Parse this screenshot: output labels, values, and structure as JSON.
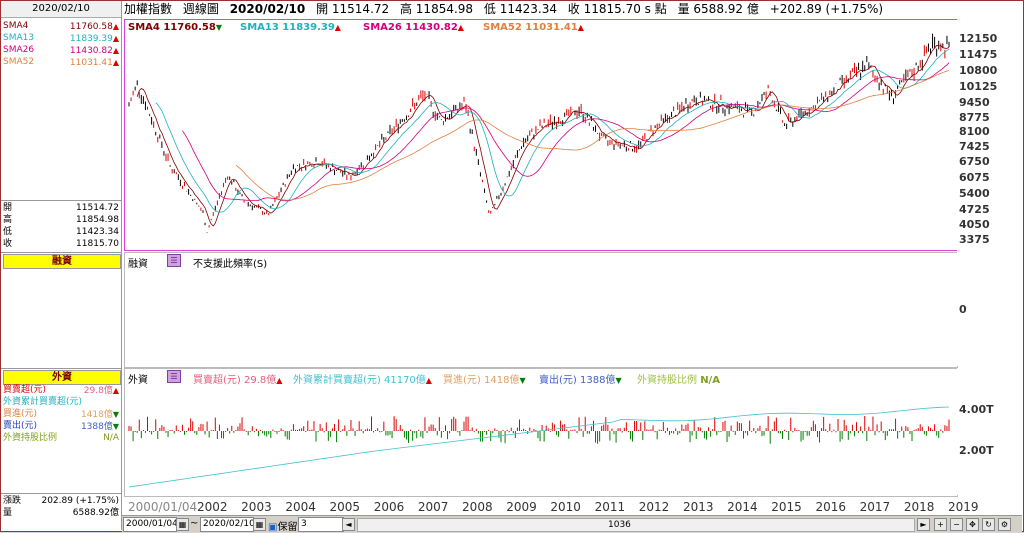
{
  "left_panel": {
    "date": "2020/02/10",
    "sma": [
      {
        "label": "SMA4",
        "value": "11760.58",
        "dir": "up",
        "color": "#800000"
      },
      {
        "label": "SMA13",
        "value": "11839.39",
        "dir": "up",
        "color": "#20b0c0"
      },
      {
        "label": "SMA26",
        "value": "11430.82",
        "dir": "up",
        "color": "#d00080"
      },
      {
        "label": "SMA52",
        "value": "11031.41",
        "dir": "up",
        "color": "#e08040"
      }
    ],
    "ohlc": [
      {
        "label": "開",
        "value": "11514.72"
      },
      {
        "label": "高",
        "value": "11854.98"
      },
      {
        "label": "低",
        "value": "11423.34"
      },
      {
        "label": "收",
        "value": "11815.70"
      }
    ],
    "margin_title": "融資",
    "foreign_title": "外資",
    "foreign_rows": [
      {
        "label": "買賣超(元)",
        "value": "29.8億",
        "dir": "up",
        "color": "#e00000"
      },
      {
        "label": "外資累計買賣超(元)",
        "value": "",
        "dir": "",
        "color": "#20b0c0"
      },
      {
        "label": "買進(元)",
        "value": "1418億",
        "dir": "down",
        "color": "#e08040"
      },
      {
        "label": "賣出(元)",
        "value": "1388億",
        "dir": "down",
        "color": "#2040c0"
      },
      {
        "label": "外資持股比例",
        "value": "N/A",
        "dir": "",
        "color": "#80a020"
      }
    ],
    "change_label": "漲跌",
    "change_value": "202.89 (+1.75%)",
    "volume_label": "量",
    "volume_value": "6588.92億"
  },
  "header": {
    "name": "加權指數",
    "period": "週線圖",
    "date": "2020/02/10",
    "open": "開 11514.72",
    "high": "高 11854.98",
    "low": "低 11423.34",
    "close": "收 11815.70 s 點",
    "volume": "量 6588.92 億",
    "change": "+202.89 (+1.75%)"
  },
  "price_legend": [
    {
      "text": "SMA4 11760.58",
      "dir": "down",
      "color": "#800000"
    },
    {
      "text": "SMA13 11839.39",
      "dir": "up",
      "color": "#20b0c0"
    },
    {
      "text": "SMA26 11430.82",
      "dir": "up",
      "color": "#d00080"
    },
    {
      "text": "SMA52 11031.41",
      "dir": "up",
      "color": "#e08040"
    }
  ],
  "price_axis": [
    "12150",
    "11475",
    "10800",
    "10125",
    "9450",
    "8775",
    "8100",
    "7425",
    "6750",
    "6075",
    "5400",
    "4725",
    "4050",
    "3375"
  ],
  "margin_panel": {
    "label": "融資",
    "msg": "不支援此頻率(S)",
    "axis_zero": "0"
  },
  "foreign_panel": {
    "label": "外資",
    "legend": [
      {
        "text": "買賣超(元) 29.8億",
        "dir": "up",
        "color": "#e06080"
      },
      {
        "text": "外資累計買賣超(元) 41170億",
        "dir": "up",
        "color": "#40c0d0"
      },
      {
        "text": "買進(元) 1418億",
        "dir": "down",
        "color": "#e0a060"
      },
      {
        "text": "賣出(元) 1388億",
        "dir": "down",
        "color": "#4060c0"
      },
      {
        "text": "外資持股比例",
        "dir": "",
        "color": "#a0c040"
      },
      {
        "text": "N/A",
        "dir": "",
        "color": "#80a020"
      }
    ],
    "axis": [
      "4.00T",
      "2.00T"
    ]
  },
  "x_axis": {
    "start": "2000/01/04",
    "years": [
      "2002",
      "2003",
      "2004",
      "2005",
      "2006",
      "2007",
      "2008",
      "2009",
      "2010",
      "2011",
      "2012",
      "2013",
      "2014",
      "2015",
      "2016",
      "2017",
      "2018",
      "2019"
    ]
  },
  "status_bar": {
    "from_date": "2000/01/04",
    "to_date": "2020/02/10",
    "tilde": "~",
    "keep_label": "保留空間",
    "keep_value": "3",
    "count": "1036"
  },
  "colors": {
    "up": "#e00000",
    "down": "#008000",
    "border": "#e040e0",
    "yellow": "#ffff00"
  }
}
